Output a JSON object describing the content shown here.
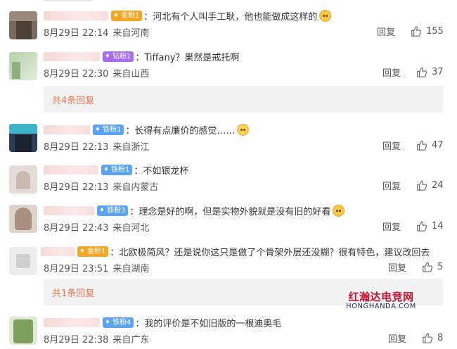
{
  "comments": [
    {
      "badge": "金粉1",
      "badge_color": "#f5a623",
      "text": "：河北有个人叫手工耿，他也能做成这样的",
      "emoji": "cat-face-icon",
      "date": "8月29日 22:14",
      "location": "来自河南",
      "reply": "回复",
      "likes": "155"
    },
    {
      "badge": "钻粉1",
      "badge_color": "#a66df0",
      "text": "：Tiffany？果然是戒托啊",
      "emoji": "",
      "date": "8月29日 22:30",
      "location": "来自山西",
      "reply": "回复",
      "likes": "37"
    },
    {
      "badge": "铁粉1",
      "badge_color": "#5ba4f4",
      "text": "：长得有点廉价的感觉……",
      "emoji": "sweat-face-icon",
      "date": "8月29日 22:13",
      "location": "来自浙江",
      "reply": "回复",
      "likes": "47"
    },
    {
      "badge": "铁粉1",
      "badge_color": "#5ba4f4",
      "text": "：不如银龙杯",
      "emoji": "",
      "date": "8月29日 22:13",
      "location": "来自内蒙古",
      "reply": "回复",
      "likes": "24"
    },
    {
      "badge": "铁粉3",
      "badge_color": "#5ba4f4",
      "text": "：理念是好的啊，但是实物外貌就是没有旧的好看",
      "emoji": "thinking-face-icon",
      "date": "8月29日 22:43",
      "location": "来自河北",
      "reply": "回复",
      "likes": "14"
    },
    {
      "badge": "金粉1",
      "badge_color": "#f5a623",
      "text": "：北欧极简风？还是说你这只是做了个骨架外层还没糊？很有特色，建议改回去",
      "emoji": "",
      "date": "8月29日 23:51",
      "location": "来自湖南",
      "reply": "回复",
      "likes": "5"
    },
    {
      "badge": "铁粉4",
      "badge_color": "#5ba4f4",
      "text": "：我的评价是不如旧版的一根迪奥毛",
      "emoji": "",
      "date": "8月29日 22:38",
      "location": "来自广东",
      "reply": "回复",
      "likes": "8"
    }
  ],
  "more_replies": [
    "共4条回复",
    "共1条回复"
  ],
  "watermark": {
    "cn": "红瀚达电竞网",
    "en": "HONGHANDA.COM"
  },
  "colors": {
    "link": "#e8734e",
    "bar_bg": "#f2f2f2",
    "watermark_red": "#c8102e"
  }
}
